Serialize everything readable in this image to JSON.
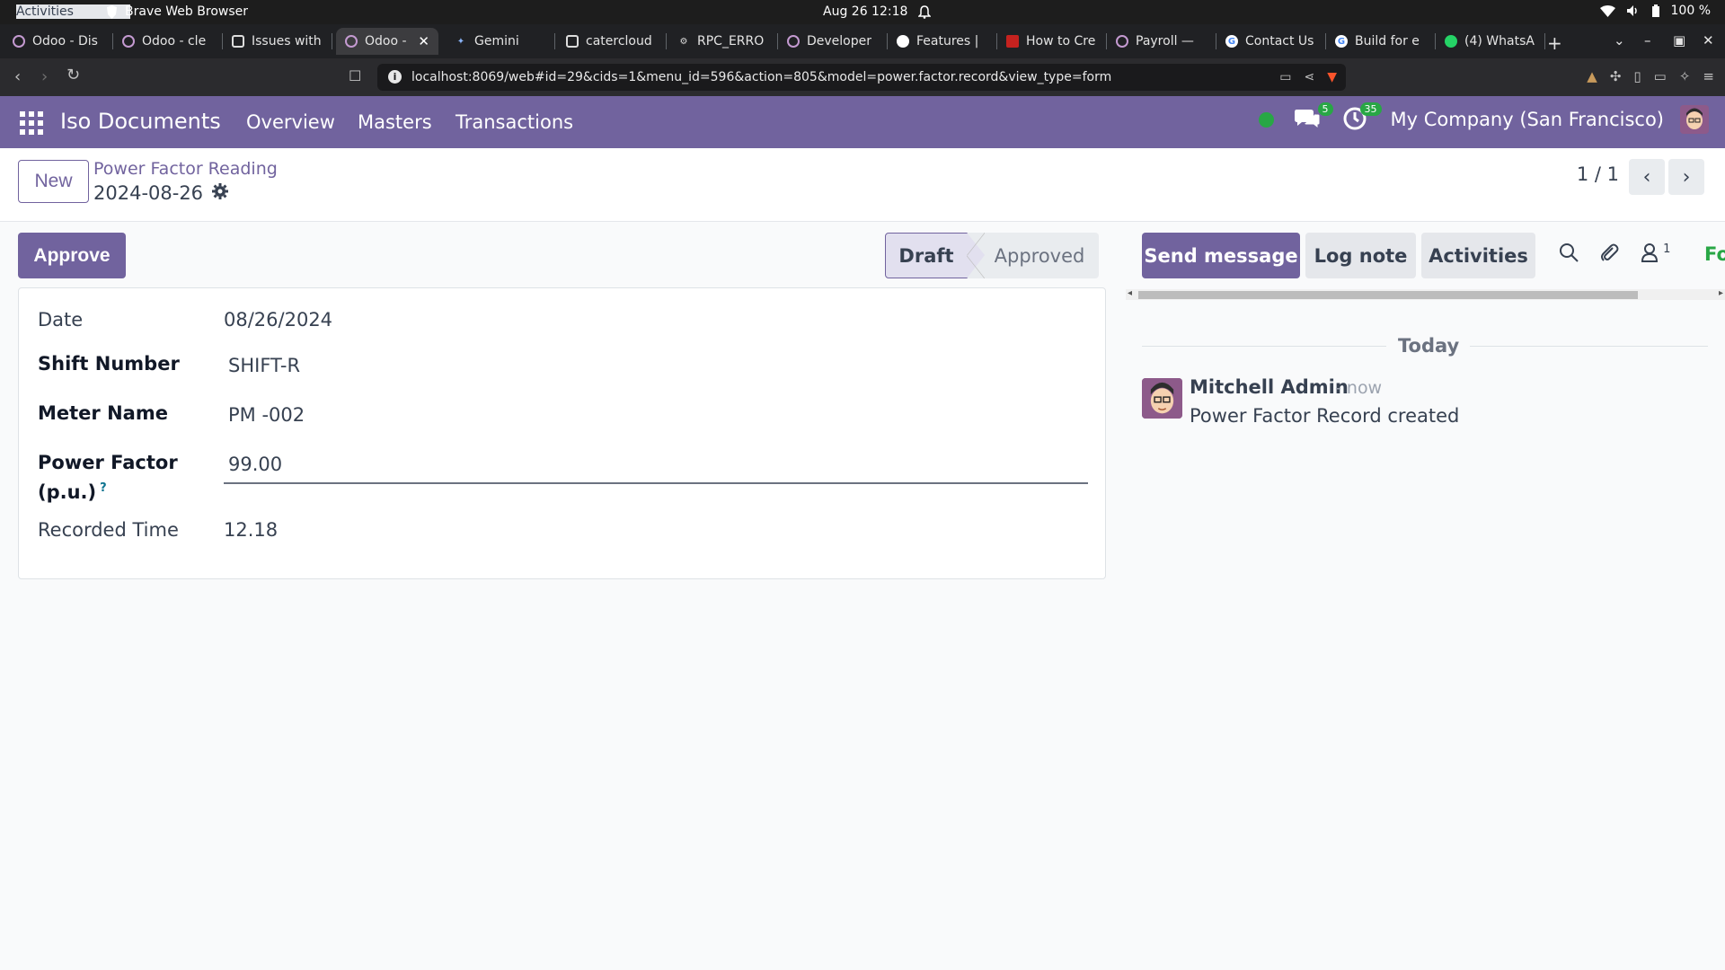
{
  "os": {
    "activities": "Activities",
    "app_name": "Brave Web Browser",
    "clock": "Aug 26  12:18",
    "battery": "100 %"
  },
  "browser": {
    "tabs": [
      {
        "label": "Odoo - Dis",
        "favicon": "odoo-icon"
      },
      {
        "label": "Odoo - cle",
        "favicon": "odoo-icon"
      },
      {
        "label": "Issues with",
        "favicon": "chatgpt-icon"
      },
      {
        "label": "Odoo -",
        "favicon": "odoo-icon",
        "active": true
      },
      {
        "label": "Gemini",
        "favicon": "gemini-icon"
      },
      {
        "label": "catercloud",
        "favicon": "chatgpt-icon"
      },
      {
        "label": "RPC_ERRO",
        "favicon": "gear-icon"
      },
      {
        "label": "Developer",
        "favicon": "odoo-icon"
      },
      {
        "label": "Features |",
        "favicon": "github-icon"
      },
      {
        "label": "How to Cre",
        "favicon": "doc-icon"
      },
      {
        "label": "Payroll — ",
        "favicon": "odoo-icon"
      },
      {
        "label": "Contact Us",
        "favicon": "google-icon"
      },
      {
        "label": "Build for e",
        "favicon": "google-icon"
      },
      {
        "label": "(4) WhatsA",
        "favicon": "whatsapp-icon"
      }
    ],
    "url": "localhost:8069/web#id=29&cids=1&menu_id=596&action=805&model=power.factor.record&view_type=form"
  },
  "navbar": {
    "brand": "Iso Documents",
    "menus": [
      "Overview",
      "Masters",
      "Transactions"
    ],
    "messages_count": "5",
    "activities_count": "35",
    "company": "My Company (San Francisco)"
  },
  "control_panel": {
    "new_label": "New",
    "breadcrumb_parent": "Power Factor Reading",
    "breadcrumb_current": "2024-08-26",
    "pager": "1 / 1"
  },
  "form": {
    "approve_label": "Approve",
    "status": {
      "draft": "Draft",
      "approved": "Approved",
      "current": "Draft"
    },
    "fields": {
      "date_label": "Date",
      "date_value": "08/26/2024",
      "shift_label": "Shift Number",
      "shift_value": "SHIFT-R",
      "meter_label": "Meter Name",
      "meter_value": "PM -002",
      "pf_label_1": "Power Factor",
      "pf_label_2": "(p.u.)",
      "pf_help": "?",
      "pf_value": "99.00",
      "time_label": "Recorded Time",
      "time_value": "12.18"
    }
  },
  "chatter": {
    "send_message": "Send message",
    "log_note": "Log note",
    "activities": "Activities",
    "followers_count": "1",
    "follow_label": "Fo",
    "date_separator": "Today",
    "message": {
      "author": "Mitchell Admin",
      "time": "- now",
      "body": "Power Factor Record created"
    }
  },
  "colors": {
    "brand": "#71639e",
    "success": "#28a745"
  }
}
